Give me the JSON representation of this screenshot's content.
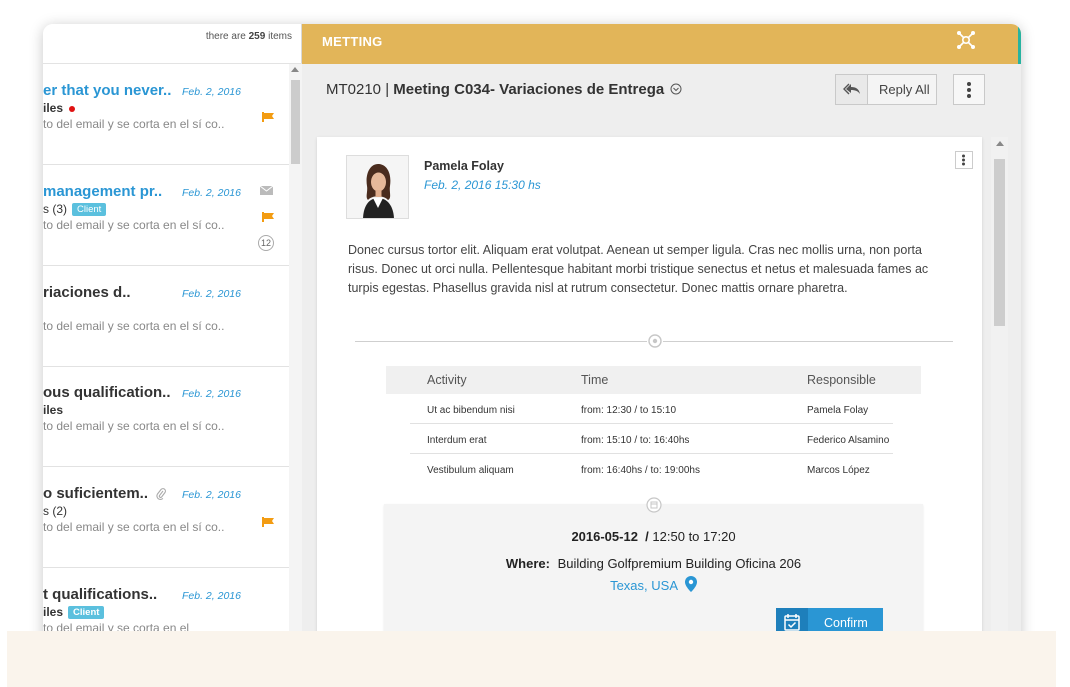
{
  "list": {
    "count_prefix": "there are",
    "count": "259",
    "count_suffix": "items",
    "messages": [
      {
        "subject": "er that you never..",
        "date": "Feb. 2, 2016",
        "from": "iles",
        "preview": "to del email y se corta en el sí co..",
        "unread_dot": true,
        "flag": true
      },
      {
        "subject": "management pr..",
        "date": "Feb. 2, 2016",
        "from": "s (3)",
        "tag": "Client",
        "preview": "to del email y se corta en el sí co..",
        "envelope": true,
        "flag": true,
        "badge": "12"
      },
      {
        "subject": "riaciones d..",
        "date": "Feb. 2, 2016",
        "from": "",
        "preview": "to del email y se corta en el sí co.."
      },
      {
        "subject": "ous qualification..",
        "date": "Feb. 2, 2016",
        "from": "iles",
        "preview": "to del email y se corta en el sí co.."
      },
      {
        "subject": "o suficientem..",
        "date": "Feb. 2, 2016",
        "from": "s (2)",
        "preview": "to del email y se corta en el sí co..",
        "attachment": true,
        "flag": true
      },
      {
        "subject": "t qualifications..",
        "date": "Feb. 2, 2016",
        "from": "iles",
        "tag": "Client",
        "preview": "to del email y se corta en el"
      }
    ]
  },
  "topbar": {
    "title": "METTING"
  },
  "header": {
    "code": "MT0210",
    "separator": "|",
    "title": "Meeting  C034- Variaciones de Entrega",
    "reply_all_label": "Reply All"
  },
  "message": {
    "sender": "Pamela Folay",
    "date": "Feb. 2, 2016  15:30 hs",
    "body": "Donec cursus tortor elit. Aliquam erat volutpat. Aenean ut semper ligula. Cras nec mollis urna, non porta risus. Donec ut orci nulla. Pellentesque habitant morbi tristique senectus et netus et malesuada fames ac turpis egestas. Phasellus gravida nisl at rutrum consectetur. Donec mattis ornare pharetra."
  },
  "agenda": {
    "headers": [
      "Activity",
      "Time",
      "Responsible"
    ],
    "rows": [
      [
        "Ut ac bibendum nisi",
        "from: 12:30 / to 15:10",
        "Pamela Folay"
      ],
      [
        "Interdum erat",
        "from: 15:10 / to: 16:40hs",
        "Federico Alsamino"
      ],
      [
        "Vestibulum aliquam",
        "from: 16:40hs / to: 19:00hs",
        "Marcos López"
      ]
    ]
  },
  "event": {
    "date": "2016-05-12",
    "slash": "/",
    "time": "12:50 to 17:20",
    "where_label": "Where:",
    "where": "Building Golfpremium Building Oficina 206",
    "location": "Texas, USA",
    "confirm_label": "Confirm"
  },
  "colors": {
    "accent_bar": "#e2b559",
    "link_blue": "#2a96d4",
    "flag_orange": "#f39c12",
    "tag_cyan": "#5bc0de",
    "teal_edge": "#27b3a0"
  }
}
